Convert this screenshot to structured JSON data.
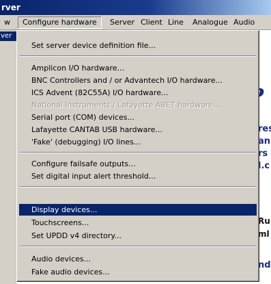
{
  "window": {
    "title": "rver"
  },
  "left_selected_text": "ver",
  "menubar": {
    "items": [
      {
        "label": "w",
        "state": "normal"
      },
      {
        "label": "Configure hardware",
        "state": "open"
      },
      {
        "label": "Server",
        "state": "normal"
      },
      {
        "label": "Client",
        "state": "normal"
      },
      {
        "label": "Line",
        "state": "normal"
      },
      {
        "label": "Analogue",
        "state": "normal"
      },
      {
        "label": "Audio",
        "state": "normal"
      }
    ]
  },
  "dropdown": {
    "groups": [
      [
        {
          "label": "Set server device definition file...",
          "state": "normal"
        }
      ],
      [
        {
          "label": "Amplicon I/O hardware...",
          "state": "normal"
        },
        {
          "label": "BNC Controllers and / or Advantech I/O hardware...",
          "state": "normal"
        },
        {
          "label": "ICS Advent (82C55A) I/O hardware...",
          "state": "normal"
        },
        {
          "label": "National Instruments / Lafayette ABET hardware...",
          "state": "disabled"
        },
        {
          "label": "Serial port (COM) devices...",
          "state": "normal"
        },
        {
          "label": "Lafayette CANTAB USB hardware...",
          "state": "normal"
        },
        {
          "label": "'Fake' (debugging) I/O lines...",
          "state": "normal"
        }
      ],
      [
        {
          "label": "Configure failsafe outputs...",
          "state": "normal"
        },
        {
          "label": "Set digital input alert threshold...",
          "state": "normal"
        }
      ],
      [
        {
          "label": "Display devices...",
          "state": "selected"
        },
        {
          "label": "Touchscreens...",
          "state": "normal"
        },
        {
          "label": "Set UPDD v4 directory...",
          "state": "normal"
        }
      ],
      [
        {
          "label": "Audio devices...",
          "state": "normal"
        },
        {
          "label": "Fake audio devices...",
          "state": "normal"
        }
      ]
    ]
  },
  "background_fragments": {
    "big_glyph": "?",
    "line1": "res",
    "line2": "an",
    "line3": "rs",
    "line4": "l.c",
    "line5": "Ru",
    "line6": "ml",
    "line7": "nd"
  },
  "colors": {
    "titlebar_start": "#0a246a",
    "menu_face": "#d4d0c8",
    "selection": "#0a246a",
    "bg_text_blue": "#1a2b7a"
  }
}
